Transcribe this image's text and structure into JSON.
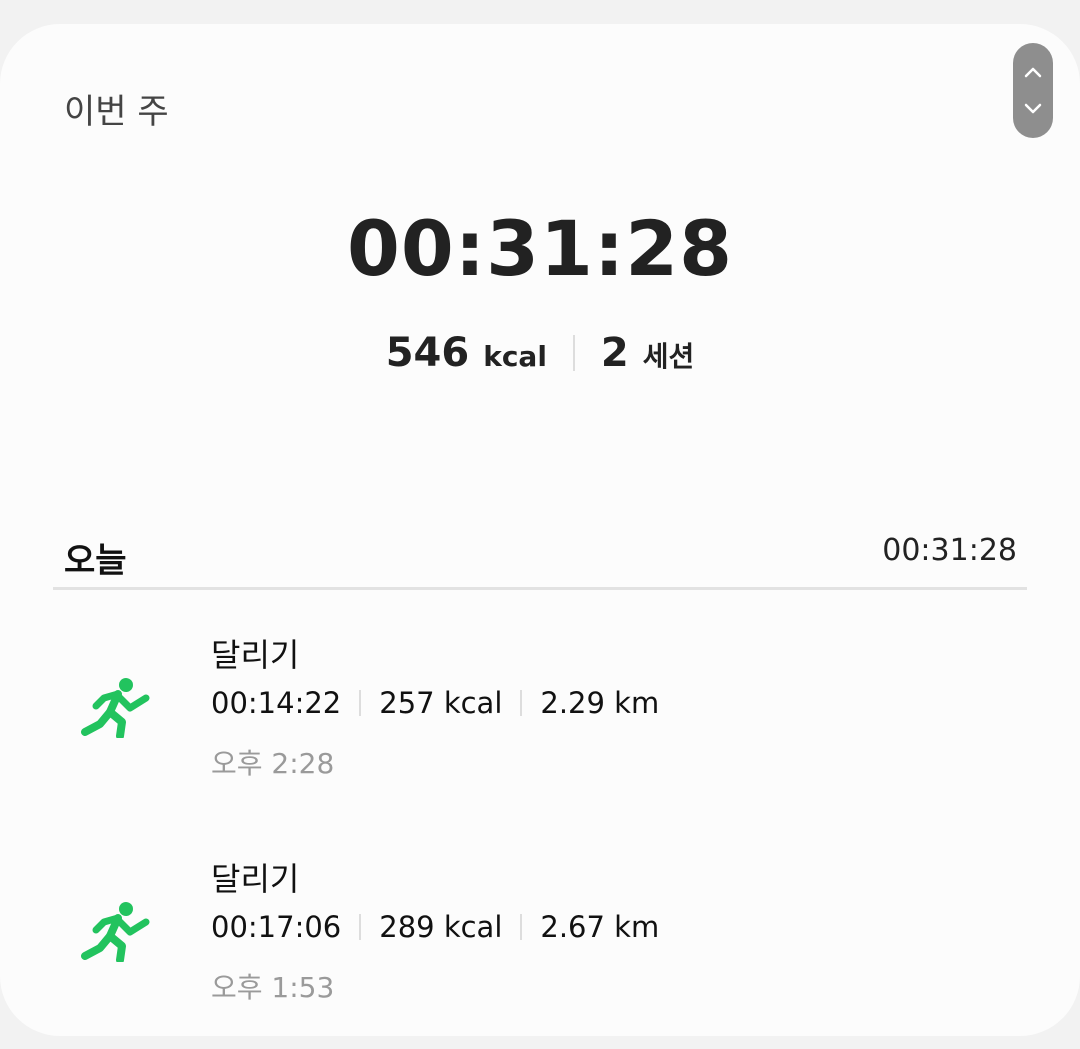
{
  "summary": {
    "period_label": "이번 주",
    "total_time": "00:31:28",
    "calories_value": "546",
    "calories_unit": "kcal",
    "sessions_value": "2",
    "sessions_unit": "세션"
  },
  "today": {
    "label": "오늘",
    "total_time": "00:31:28"
  },
  "sessions": [
    {
      "name": "달리기",
      "duration": "00:14:22",
      "calories": "257 kcal",
      "distance": "2.29 km",
      "time": "오후 2:28"
    },
    {
      "name": "달리기",
      "duration": "00:17:06",
      "calories": "289 kcal",
      "distance": "2.67 km",
      "time": "오후 1:53"
    }
  ],
  "icons": {
    "activity": "running-icon",
    "scroll_up": "chevron-up-icon",
    "scroll_down": "chevron-down-icon"
  },
  "colors": {
    "activity_icon": "#22c35e",
    "scroll_pill": "#8e8e8e",
    "secondary_text": "#9a9a9a"
  }
}
